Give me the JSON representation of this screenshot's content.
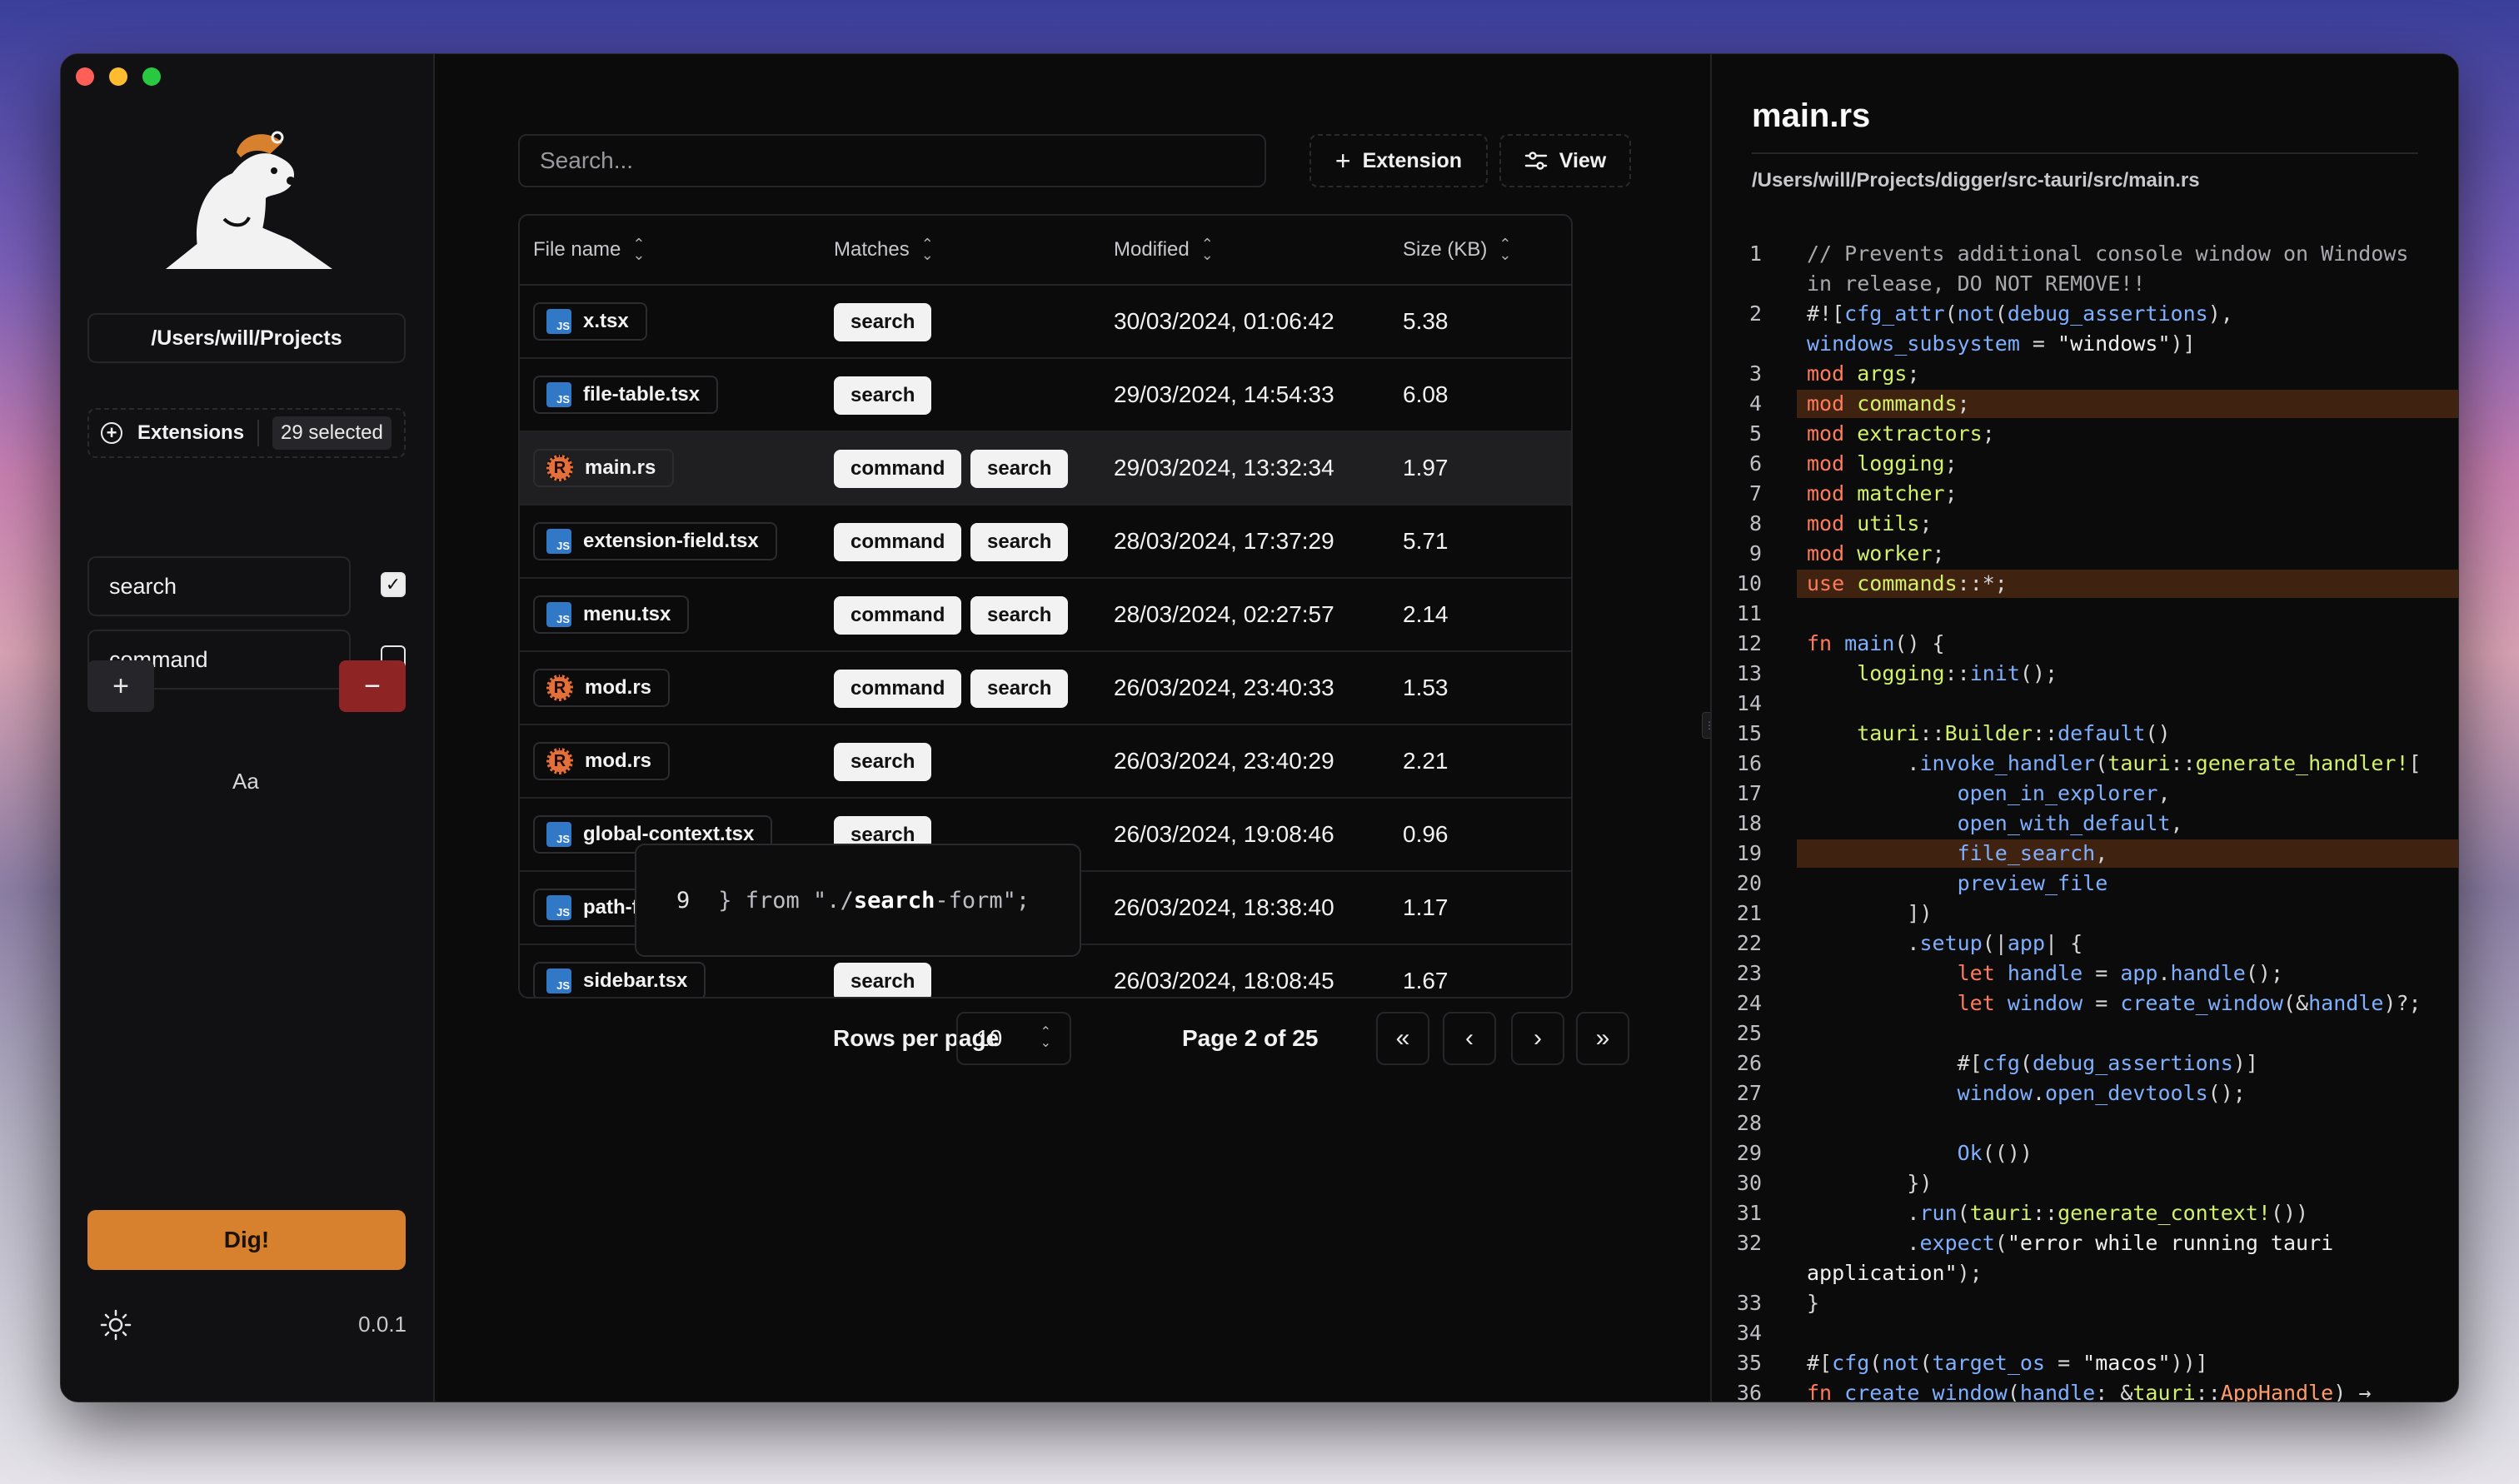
{
  "sidebar": {
    "path": "/Users/will/Projects",
    "extensions_label": "Extensions",
    "extensions_badge": "29 selected",
    "terms": [
      {
        "value": "search",
        "checked": true
      },
      {
        "value": "command",
        "checked": false
      }
    ],
    "add_label": "+",
    "remove_label": "−",
    "case_label": "Aa",
    "dig_label": "Dig!",
    "version": "0.0.1"
  },
  "toolbar": {
    "search_placeholder": "Search...",
    "extension_label": "Extension",
    "view_label": "View"
  },
  "table": {
    "headers": [
      "File name",
      "Matches",
      "Modified",
      "Size (KB)"
    ],
    "rows": [
      {
        "name": "x.tsx",
        "icon": "typescript-icon",
        "matches": [
          "search"
        ],
        "modified": "30/03/2024, 01:06:42",
        "size": "5.38"
      },
      {
        "name": "file-table.tsx",
        "icon": "typescript-icon",
        "matches": [
          "search"
        ],
        "modified": "29/03/2024, 14:54:33",
        "size": "6.08"
      },
      {
        "name": "main.rs",
        "icon": "rust-icon",
        "matches": [
          "command",
          "search"
        ],
        "modified": "29/03/2024, 13:32:34",
        "size": "1.97"
      },
      {
        "name": "extension-field.tsx",
        "icon": "typescript-icon",
        "matches": [
          "command",
          "search"
        ],
        "modified": "28/03/2024, 17:37:29",
        "size": "5.71"
      },
      {
        "name": "menu.tsx",
        "icon": "typescript-icon",
        "matches": [
          "command",
          "search"
        ],
        "modified": "28/03/2024, 02:27:57",
        "size": "2.14"
      },
      {
        "name": "mod.rs",
        "icon": "rust-icon",
        "matches": [
          "command",
          "search"
        ],
        "modified": "26/03/2024, 23:40:33",
        "size": "1.53"
      },
      {
        "name": "mod.rs",
        "icon": "rust-icon",
        "matches": [
          "search"
        ],
        "modified": "26/03/2024, 23:40:29",
        "size": "2.21"
      },
      {
        "name": "global-context.tsx",
        "icon": "typescript-icon",
        "matches": [
          "search"
        ],
        "modified": "26/03/2024, 19:08:46",
        "size": "0.96"
      },
      {
        "name": "path-fi",
        "icon": "typescript-icon",
        "matches": [],
        "modified": "26/03/2024, 18:38:40",
        "size": "1.17"
      },
      {
        "name": "sidebar.tsx",
        "icon": "typescript-icon",
        "matches": [
          "search"
        ],
        "modified": "26/03/2024, 18:08:45",
        "size": "1.67"
      }
    ],
    "popover": {
      "line": "9",
      "pre": "} from \"./",
      "match": "search",
      "post": "-form\";"
    }
  },
  "pagination": {
    "rows_per_page_label": "Rows per page",
    "rows_per_page_value": "10",
    "page_label": "Page 2 of 25"
  },
  "preview": {
    "title": "main.rs",
    "path": "/Users/will/Projects/digger/src-tauri/src/main.rs",
    "highlighted_lines": [
      4,
      10,
      19
    ]
  }
}
